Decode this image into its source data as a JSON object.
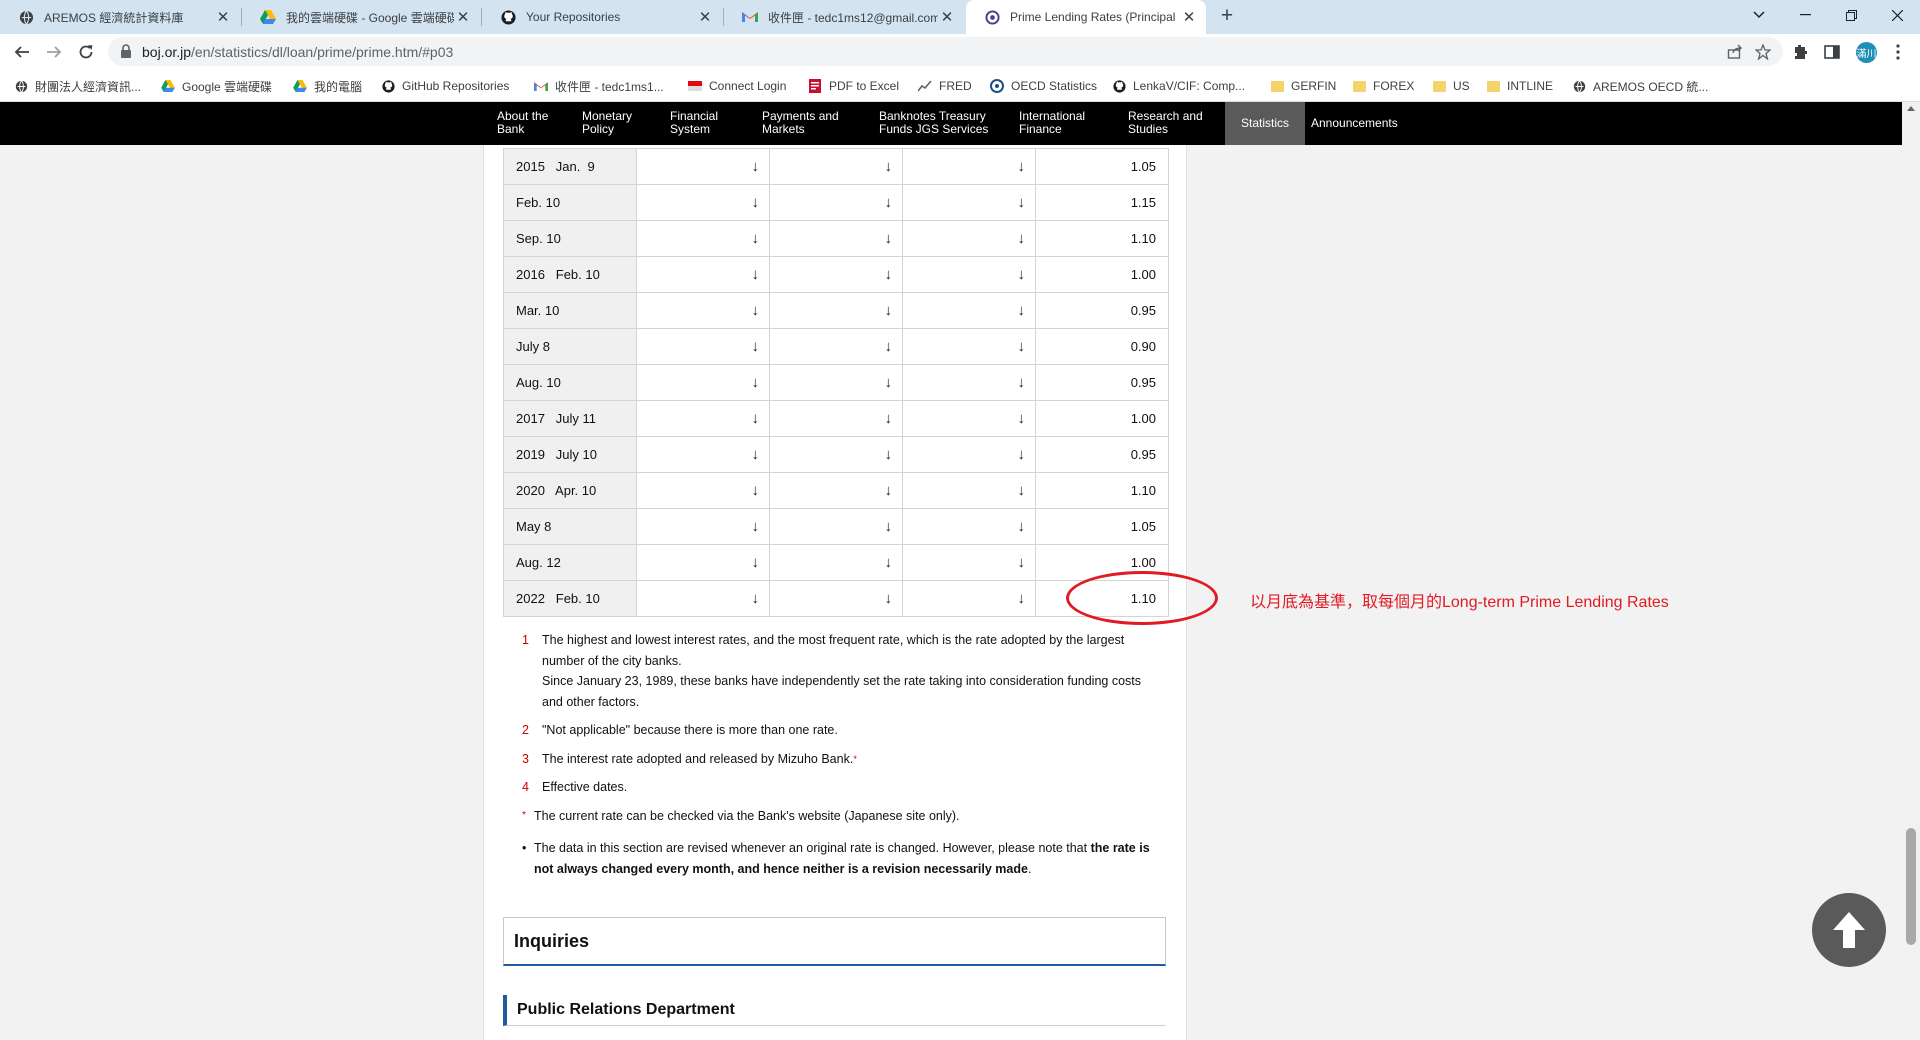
{
  "tabs": [
    {
      "title": "AREMOS 經濟統計資料庫",
      "icon": "aremos-globe-icon"
    },
    {
      "title": "我的雲端硬碟 - Google 雲端硬碟",
      "icon": "google-drive-icon"
    },
    {
      "title": "Your Repositories",
      "icon": "github-icon"
    },
    {
      "title": "收件匣 - tedc1ms12@gmail.com",
      "icon": "gmail-icon"
    },
    {
      "title": "Prime Lending Rates (Principal",
      "icon": "boj-icon",
      "active": true
    }
  ],
  "address_bar": {
    "host": "boj.or.jp",
    "path": "/en/statistics/dl/loan/prime/prime.htm/#p03"
  },
  "profile_initials": "滿川",
  "bookmarks": [
    {
      "label": "財團法人經濟資訊...",
      "icon": "aremos-globe-icon"
    },
    {
      "label": "Google 雲端硬碟",
      "icon": "google-drive-icon"
    },
    {
      "label": "我的電腦",
      "icon": "google-drive-icon"
    },
    {
      "label": "GitHub Repositories",
      "icon": "github-icon"
    },
    {
      "label": "收件匣 - tedc1ms1...",
      "icon": "gmail-icon"
    },
    {
      "label": "Connect Login",
      "icon": "flag-icon"
    },
    {
      "label": "PDF to Excel",
      "icon": "pdf-icon"
    },
    {
      "label": "FRED",
      "icon": "chart-icon"
    },
    {
      "label": "OECD Statistics",
      "icon": "oecd-icon"
    },
    {
      "label": "LenkaV/CIF: Comp...",
      "icon": "github-icon"
    },
    {
      "label": "GERFIN",
      "icon": "folder-icon"
    },
    {
      "label": "FOREX",
      "icon": "folder-icon"
    },
    {
      "label": "US",
      "icon": "folder-icon"
    },
    {
      "label": "INTLINE",
      "icon": "folder-icon"
    },
    {
      "label": "AREMOS OECD 統...",
      "icon": "aremos-globe-icon"
    }
  ],
  "site_nav": [
    {
      "line1": "About the",
      "line2": "Bank"
    },
    {
      "line1": "Monetary",
      "line2": "Policy"
    },
    {
      "line1": "Financial",
      "line2": "System"
    },
    {
      "line1": "Payments and",
      "line2": "Markets"
    },
    {
      "line1": "Banknotes Treasury",
      "line2": "Funds JGS Services"
    },
    {
      "line1": "International",
      "line2": "Finance"
    },
    {
      "line1": "Research and",
      "line2": "Studies"
    },
    {
      "line1": "Statistics",
      "line2": ""
    },
    {
      "line1": "Announcements",
      "line2": ""
    }
  ],
  "table": {
    "arrow_symbol": "↓",
    "rows": [
      {
        "date": "2015   Jan.  9",
        "rate": "1.05"
      },
      {
        "date": "Feb. 10",
        "rate": "1.15"
      },
      {
        "date": "Sep. 10",
        "rate": "1.10"
      },
      {
        "date": "2016   Feb. 10",
        "rate": "1.00"
      },
      {
        "date": "Mar. 10",
        "rate": "0.95"
      },
      {
        "date": "July 8",
        "rate": "0.90"
      },
      {
        "date": "Aug. 10",
        "rate": "0.95"
      },
      {
        "date": "2017   July 11",
        "rate": "1.00"
      },
      {
        "date": "2019   July 10",
        "rate": "0.95"
      },
      {
        "date": "2020   Apr. 10",
        "rate": "1.10"
      },
      {
        "date": "May 8",
        "rate": "1.05"
      },
      {
        "date": "Aug. 12",
        "rate": "1.00"
      },
      {
        "date": "2022   Feb. 10",
        "rate": "1.10"
      }
    ]
  },
  "annotation": {
    "text": "以月底為基準，取每個月的Long-term Prime Lending Rates",
    "color": "#e01b24"
  },
  "notes": [
    {
      "num": "1",
      "line1": "The highest and lowest interest rates, and the most frequent rate, which is the rate adopted by the largest number of the city banks.",
      "line2": "Since January 23, 1989, these banks have independently set the rate taking into consideration funding costs and other factors."
    },
    {
      "num": "2",
      "line1": "\"Not applicable\" because there is more than one rate."
    },
    {
      "num": "3",
      "line1": "The interest rate adopted and released by Mizuho Bank.",
      "sup": "*"
    },
    {
      "num": "4",
      "line1": "Effective dates."
    }
  ],
  "star_note": {
    "symbol": "*",
    "text": "The current rate can be checked via the Bank's website (Japanese site only)."
  },
  "bullet_note": {
    "plain": "The data in this section are revised whenever an original rate is changed. However, please note that ",
    "bold": "the rate is not always changed every month, and hence neither is a revision necessarily made",
    "end": "."
  },
  "inquiries_heading": "Inquiries",
  "department_heading": "Public Relations Department",
  "colors": {
    "nav_bg": "#000000",
    "stats_bg": "#5a5a5a",
    "accent_blue": "#1f5b9e",
    "note_red": "#cc0000"
  }
}
